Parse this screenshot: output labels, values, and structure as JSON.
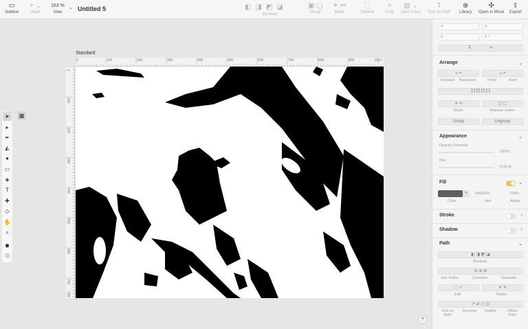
{
  "toolbar": {
    "sidebar_label": "Sidebar",
    "heart_label": "Heart",
    "view_value": "163 %",
    "view_label": "View",
    "doc_title": "Untitled 5",
    "boolean_label": "Boolean",
    "group_label": "Group",
    "mask_label": "Mask",
    "outline_label": "Outline",
    "crop_label": "Crop",
    "auto_trace_label": "Auto Trace",
    "text_on_path_label": "Text on Path",
    "library_label": "Library",
    "open_in_move_label": "Open in Move",
    "export_label": "Export"
  },
  "canvas": {
    "artboard_name": "Standard",
    "hruler_ticks": [
      "0",
      "100",
      "200",
      "300",
      "400",
      "500",
      "600",
      "700",
      "800",
      "900",
      "1024"
    ],
    "vruler_ticks": [
      "0",
      "100",
      "200",
      "300",
      "400",
      "500",
      "600",
      "700",
      "768"
    ]
  },
  "inspector": {
    "pos": {
      "x": "0",
      "y": "0",
      "w": "0",
      "h": "0",
      "rot": "0 °"
    },
    "arrange": {
      "title": "Arrange",
      "forward": "Forward",
      "backward": "Backward",
      "front": "Front",
      "back": "Back",
      "mask": "Mask",
      "release_action": "Release action",
      "group": "Group",
      "ungroup": "Ungroup"
    },
    "appearance": {
      "title": "Appearance",
      "opacity_label": "Opacity (Normal)",
      "opacity_value": "100%",
      "blur_label": "Blur",
      "blur_value": "0.00 pt"
    },
    "fill": {
      "title": "Fill",
      "color": "#5e5e5e",
      "hex_value": "#000000",
      "alpha_value": "100%",
      "color_label": "Color",
      "hex_label": "Hex",
      "alpha_label": "Alpha",
      "enabled": true
    },
    "stroke": {
      "title": "Stroke"
    },
    "shadow": {
      "title": "Shadow"
    },
    "path": {
      "title": "Path",
      "boolean": "Boolean",
      "join_paths": "Join Paths",
      "combine": "Combine",
      "separate": "Separate",
      "edit": "Edit",
      "nodes": "Nodes",
      "text_on_path": "Text on Path",
      "reverse": "Reverse",
      "outline": "Outline",
      "offset_path": "Offset Path"
    }
  },
  "help_label": "?"
}
